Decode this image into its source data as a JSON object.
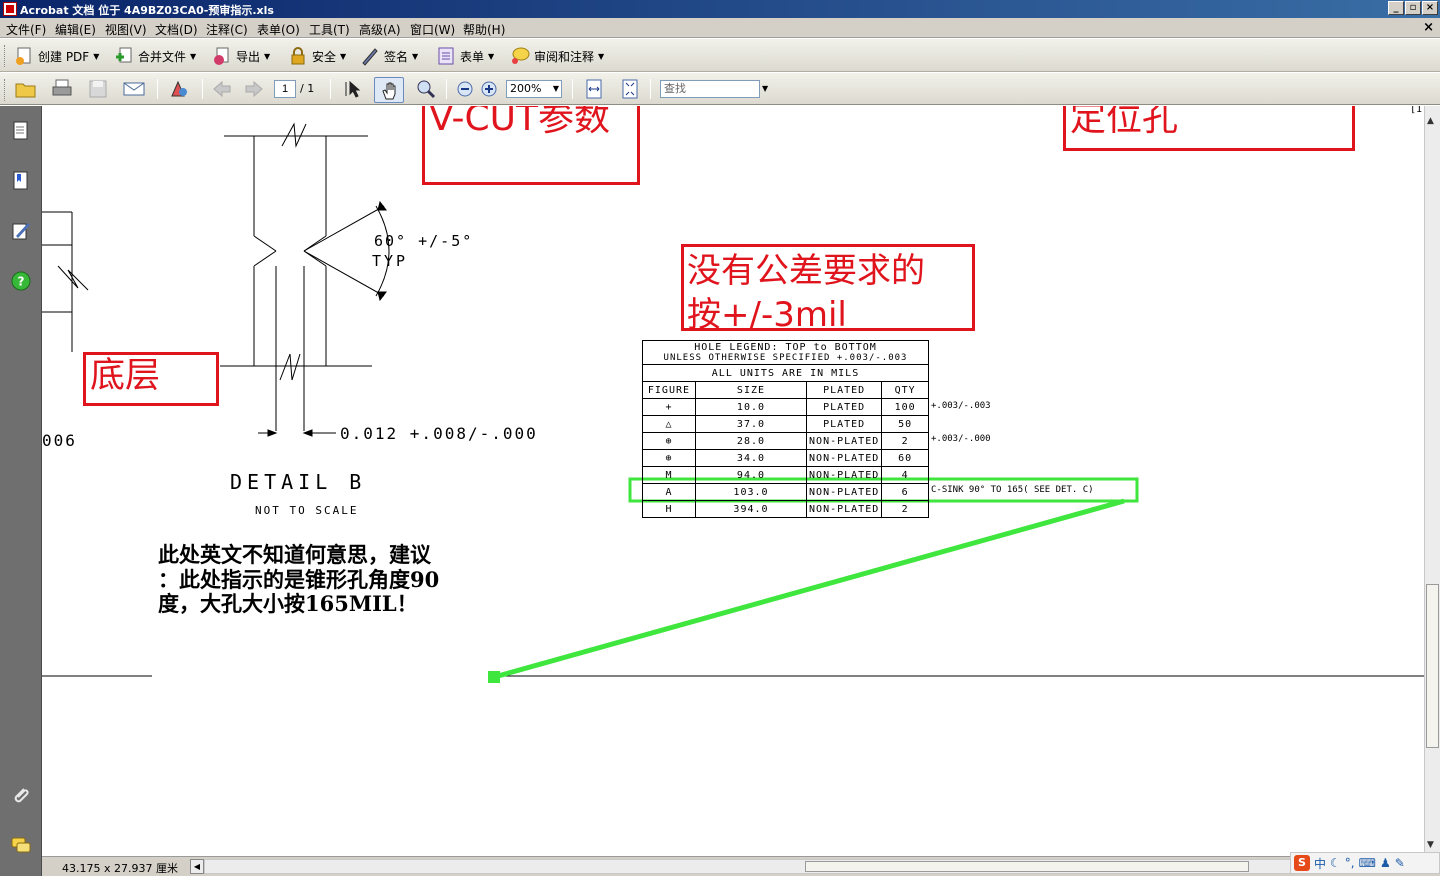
{
  "window": {
    "title": "Acrobat 文档 位于 4A9BZ03CA0-预审指示.xls",
    "minimize_label": "_",
    "restore_label": "▫",
    "close_label": "×"
  },
  "menu": {
    "items": [
      "文件(F)",
      "编辑(E)",
      "视图(V)",
      "文档(D)",
      "注释(C)",
      "表单(O)",
      "工具(T)",
      "高级(A)",
      "窗口(W)",
      "帮助(H)"
    ],
    "doc_close": "×"
  },
  "toolbar1": {
    "create_pdf": "创建 PDF",
    "combine": "合并文件",
    "export": "导出",
    "secure": "安全",
    "sign": "签名",
    "forms": "表单",
    "review": "审阅和注释"
  },
  "toolbar2": {
    "page_current": "1",
    "page_total": "/ 1",
    "zoom": "200%",
    "find_placeholder": "查找"
  },
  "status": {
    "page_size": "43.175 x 27.937 厘米"
  },
  "ime": {
    "mode": "中"
  },
  "drawing": {
    "vcut_label": "V-CUT参数",
    "locating_hole_label": "定位孔",
    "bottom_layer_label": "底层",
    "tolerance_label_line1": "没有公差要求的",
    "tolerance_label_line2": "按+/-3mil",
    "angle_text": "60° +/-5°",
    "typ_text": "TYP",
    "thickness_text": "0.012  +.008/-.000",
    "left_partial_text": "006",
    "detail_title": "DETAIL  B",
    "detail_subtitle": "NOT TO SCALE",
    "page_marker": "[1",
    "note_line1": "此处英文不知道何意思，建议",
    "note_line2": "：此处指示的是锥形孔角度90",
    "note_line3": "度，大孔大小按165MIL！"
  },
  "hole_legend": {
    "title": "HOLE LEGEND: TOP to BOTTOM",
    "subtitle": "UNLESS OTHERWISE SPECIFIED +.003/-.003",
    "units": "ALL UNITS ARE IN MILS",
    "headers": [
      "FIGURE",
      "SIZE",
      "PLATED",
      "QTY"
    ],
    "rows": [
      {
        "figure": "+",
        "size": "10.0",
        "plated": "PLATED",
        "qty": "100",
        "note": "+.003/-.003"
      },
      {
        "figure": "△",
        "size": "37.0",
        "plated": "PLATED",
        "qty": "50",
        "note": ""
      },
      {
        "figure": "⊕",
        "size": "28.0",
        "plated": "NON-PLATED",
        "qty": "2",
        "note": "+.003/-.000"
      },
      {
        "figure": "⊕",
        "size": "34.0",
        "plated": "NON-PLATED",
        "qty": "60",
        "note": ""
      },
      {
        "figure": "M",
        "size": "94.0",
        "plated": "NON-PLATED",
        "qty": "4",
        "note": ""
      },
      {
        "figure": "A",
        "size": "103.0",
        "plated": "NON-PLATED",
        "qty": "6",
        "note": "C-SINK 90° TO 165( SEE DET. C)"
      },
      {
        "figure": "H",
        "size": "394.0",
        "plated": "NON-PLATED",
        "qty": "2",
        "note": ""
      }
    ]
  },
  "colors": {
    "annotation_red": "#e0141c",
    "highlight_green": "#3ee63e"
  }
}
